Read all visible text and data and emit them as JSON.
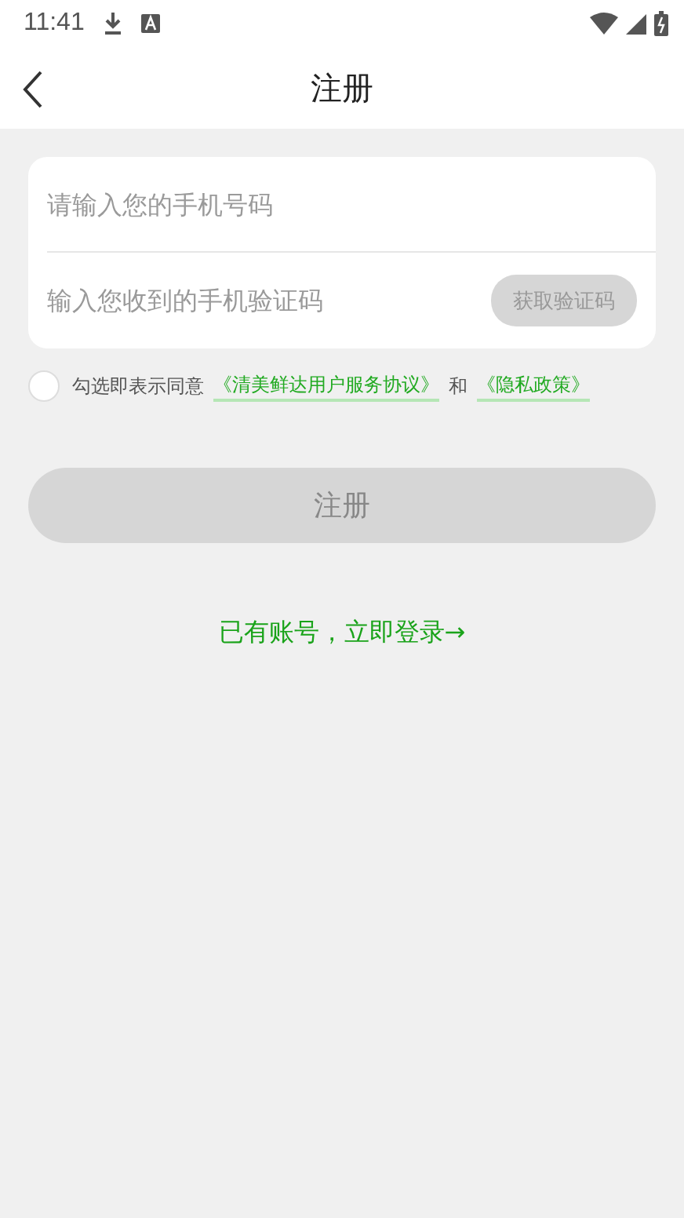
{
  "status_bar": {
    "time": "11:41"
  },
  "header": {
    "title": "注册"
  },
  "form": {
    "phone": {
      "placeholder": "请输入您的手机号码"
    },
    "code": {
      "placeholder": "输入您收到的手机验证码"
    },
    "get_code_button": {
      "label": "获取验证码",
      "disabled": true
    }
  },
  "agreement": {
    "checked": false,
    "prefix": "勾选即表示同意",
    "link_1": "《清美鲜达用户服务协议》",
    "joiner": "和",
    "link_2": "《隐私政策》"
  },
  "register_button": {
    "label": "注册",
    "disabled": true
  },
  "login_link": "已有账号，立即登录→"
}
